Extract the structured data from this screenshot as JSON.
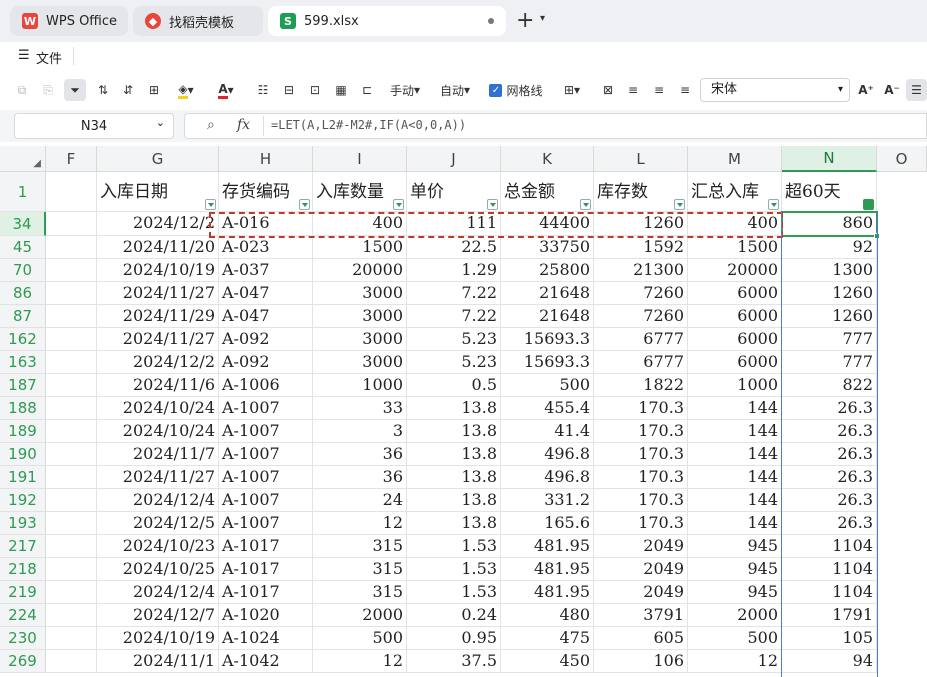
{
  "tabs": [
    {
      "label": "WPS Office"
    },
    {
      "label": "找稻壳模板"
    },
    {
      "label": "599.xlsx"
    }
  ],
  "menu": {
    "file_label": "文件"
  },
  "toolbar": {
    "manual_label": "手动",
    "auto_label": "自动",
    "gridlines_label": "网格线",
    "font_name": "宋体"
  },
  "formula_bar": {
    "cell_ref": "N34",
    "fx": "fx",
    "formula": "=LET(A,L2#-M2#,IF(A<0,0,A))"
  },
  "columns": [
    "F",
    "G",
    "H",
    "I",
    "J",
    "K",
    "L",
    "M",
    "N",
    "O"
  ],
  "header_row": {
    "num": "1",
    "cells": [
      "",
      "入库日期",
      "存货编码",
      "入库数量",
      "单价",
      "总金额",
      "库存数",
      "汇总入库",
      "超60天"
    ]
  },
  "rows": [
    {
      "num": "34",
      "cells": [
        "",
        "2024/12/2",
        "A-016",
        "400",
        "111",
        "44400",
        "1260",
        "400",
        "860"
      ]
    },
    {
      "num": "45",
      "cells": [
        "",
        "2024/11/20",
        "A-023",
        "1500",
        "22.5",
        "33750",
        "1592",
        "1500",
        "92"
      ]
    },
    {
      "num": "70",
      "cells": [
        "",
        "2024/10/19",
        "A-037",
        "20000",
        "1.29",
        "25800",
        "21300",
        "20000",
        "1300"
      ]
    },
    {
      "num": "86",
      "cells": [
        "",
        "2024/11/27",
        "A-047",
        "3000",
        "7.22",
        "21648",
        "7260",
        "6000",
        "1260"
      ]
    },
    {
      "num": "87",
      "cells": [
        "",
        "2024/11/29",
        "A-047",
        "3000",
        "7.22",
        "21648",
        "7260",
        "6000",
        "1260"
      ]
    },
    {
      "num": "162",
      "cells": [
        "",
        "2024/11/27",
        "A-092",
        "3000",
        "5.23",
        "15693.3",
        "6777",
        "6000",
        "777"
      ]
    },
    {
      "num": "163",
      "cells": [
        "",
        "2024/12/2",
        "A-092",
        "3000",
        "5.23",
        "15693.3",
        "6777",
        "6000",
        "777"
      ]
    },
    {
      "num": "187",
      "cells": [
        "",
        "2024/11/6",
        "A-1006",
        "1000",
        "0.5",
        "500",
        "1822",
        "1000",
        "822"
      ]
    },
    {
      "num": "188",
      "cells": [
        "",
        "2024/10/24",
        "A-1007",
        "33",
        "13.8",
        "455.4",
        "170.3",
        "144",
        "26.3"
      ]
    },
    {
      "num": "189",
      "cells": [
        "",
        "2024/10/24",
        "A-1007",
        "3",
        "13.8",
        "41.4",
        "170.3",
        "144",
        "26.3"
      ]
    },
    {
      "num": "190",
      "cells": [
        "",
        "2024/11/7",
        "A-1007",
        "36",
        "13.8",
        "496.8",
        "170.3",
        "144",
        "26.3"
      ]
    },
    {
      "num": "191",
      "cells": [
        "",
        "2024/11/27",
        "A-1007",
        "36",
        "13.8",
        "496.8",
        "170.3",
        "144",
        "26.3"
      ]
    },
    {
      "num": "192",
      "cells": [
        "",
        "2024/12/4",
        "A-1007",
        "24",
        "13.8",
        "331.2",
        "170.3",
        "144",
        "26.3"
      ]
    },
    {
      "num": "193",
      "cells": [
        "",
        "2024/12/5",
        "A-1007",
        "12",
        "13.8",
        "165.6",
        "170.3",
        "144",
        "26.3"
      ]
    },
    {
      "num": "217",
      "cells": [
        "",
        "2024/10/23",
        "A-1017",
        "315",
        "1.53",
        "481.95",
        "2049",
        "945",
        "1104"
      ]
    },
    {
      "num": "218",
      "cells": [
        "",
        "2024/10/25",
        "A-1017",
        "315",
        "1.53",
        "481.95",
        "2049",
        "945",
        "1104"
      ]
    },
    {
      "num": "219",
      "cells": [
        "",
        "2024/12/4",
        "A-1017",
        "315",
        "1.53",
        "481.95",
        "2049",
        "945",
        "1104"
      ]
    },
    {
      "num": "224",
      "cells": [
        "",
        "2024/12/7",
        "A-1020",
        "2000",
        "0.24",
        "480",
        "3791",
        "2000",
        "1791"
      ]
    },
    {
      "num": "230",
      "cells": [
        "",
        "2024/10/19",
        "A-1024",
        "500",
        "0.95",
        "475",
        "605",
        "500",
        "105"
      ]
    },
    {
      "num": "269",
      "cells": [
        "",
        "2024/11/1",
        "A-1042",
        "12",
        "37.5",
        "450",
        "106",
        "12",
        "94"
      ]
    }
  ],
  "colors": {
    "accent": "#2e9a52",
    "wps_red": "#e8453c",
    "copy_marquee": "#c0392b"
  }
}
